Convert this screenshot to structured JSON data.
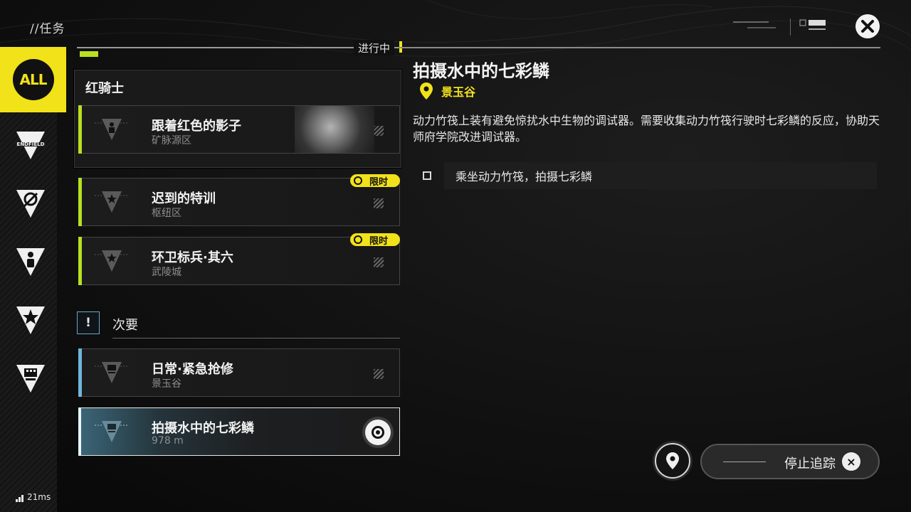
{
  "header": {
    "breadcrumb": "//任务"
  },
  "sidebar": {
    "all_label": "ALL",
    "items": [
      {
        "icon": "endfield-icon",
        "label": "ENDFIELD"
      },
      {
        "icon": "compass-icon"
      },
      {
        "icon": "person-icon"
      },
      {
        "icon": "star-icon"
      },
      {
        "icon": "building-icon"
      }
    ]
  },
  "list": {
    "in_progress_label": "进行中",
    "main_group": {
      "title": "红骑士",
      "quests": [
        {
          "name": "跟着红色的影子",
          "region": "矿脉源区"
        }
      ]
    },
    "quests": [
      {
        "name": "迟到的特训",
        "region": "枢纽区",
        "badge": "限时"
      },
      {
        "name": "环卫标兵·其六",
        "region": "武陵城",
        "badge": "限时"
      }
    ],
    "secondary_title": "次要",
    "secondary_icon_glyph": "!",
    "secondary": [
      {
        "name": "日常·紧急抢修",
        "region": "景玉谷"
      },
      {
        "name": "拍摄水中的七彩鳞",
        "region": "978 m",
        "selected": true
      }
    ]
  },
  "detail": {
    "title": "拍摄水中的七彩鳞",
    "location": "景玉谷",
    "description": "动力竹筏上装有避免惊扰水中生物的调试器。需要收集动力竹筏行驶时七彩鳞的反应，协助天师府学院改进调试器。",
    "objective": "乘坐动力竹筏，拍摄七彩鳞"
  },
  "actions": {
    "stop_tracking": "停止追踪",
    "stop_icon_glyph": "×"
  },
  "status": {
    "ping": "21ms"
  },
  "colors": {
    "accent_yellow": "#f1e21a",
    "accent_green": "#b8e020",
    "accent_blue": "#6fb6dc"
  }
}
